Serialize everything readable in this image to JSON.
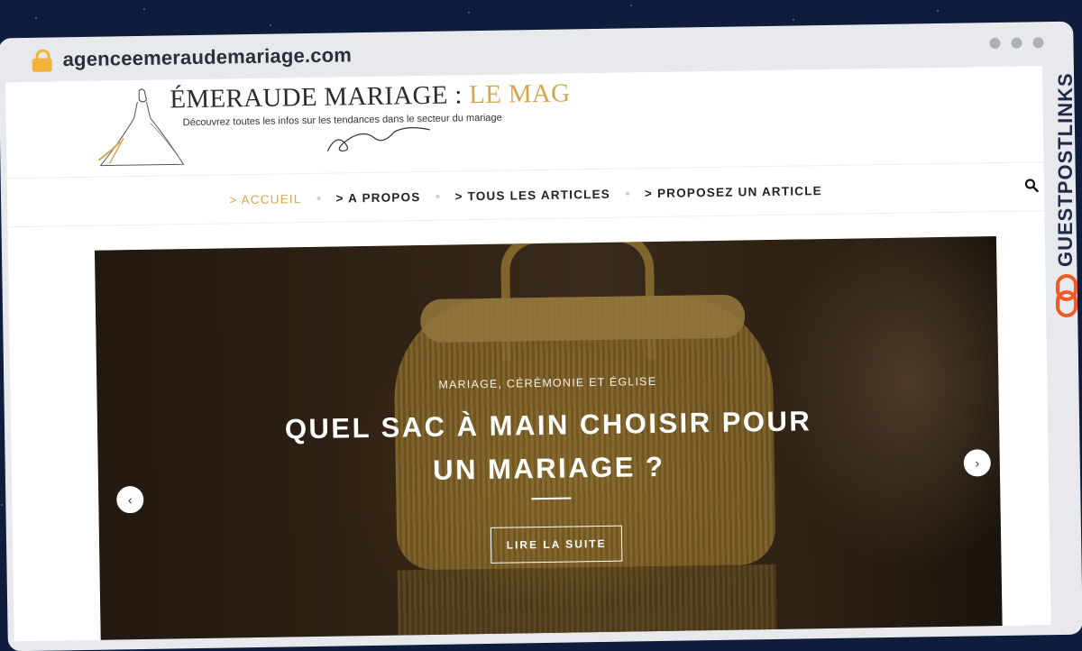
{
  "browser": {
    "url": "agenceemeraudemariage.com"
  },
  "site": {
    "title_main": "ÉMERAUDE MARIAGE : ",
    "title_accent": "LE MAG",
    "tagline": "Découvrez toutes les infos sur les tendances dans le secteur du mariage"
  },
  "nav": {
    "items": [
      {
        "label": "> ACCUEIL"
      },
      {
        "label": "> A PROPOS"
      },
      {
        "label": "> TOUS LES ARTICLES"
      },
      {
        "label": "> PROPOSEZ UN ARTICLE"
      }
    ],
    "search_icon": "search-icon"
  },
  "hero": {
    "category": "MARIAGE, CÉRÉMONIE ET ÉGLISE",
    "title": "QUEL SAC À MAIN CHOISIR POUR UN MARIAGE ?",
    "cta": "LIRE LA SUITE",
    "prev_icon": "‹",
    "next_icon": "›"
  },
  "sidebar_brand": {
    "label": "GUESTPOSTLINKS"
  },
  "colors": {
    "accent": "#d4a74e",
    "frame": "#e8e9ec",
    "brand_navy": "#1f2b49",
    "brand_orange": "#f05a28"
  }
}
